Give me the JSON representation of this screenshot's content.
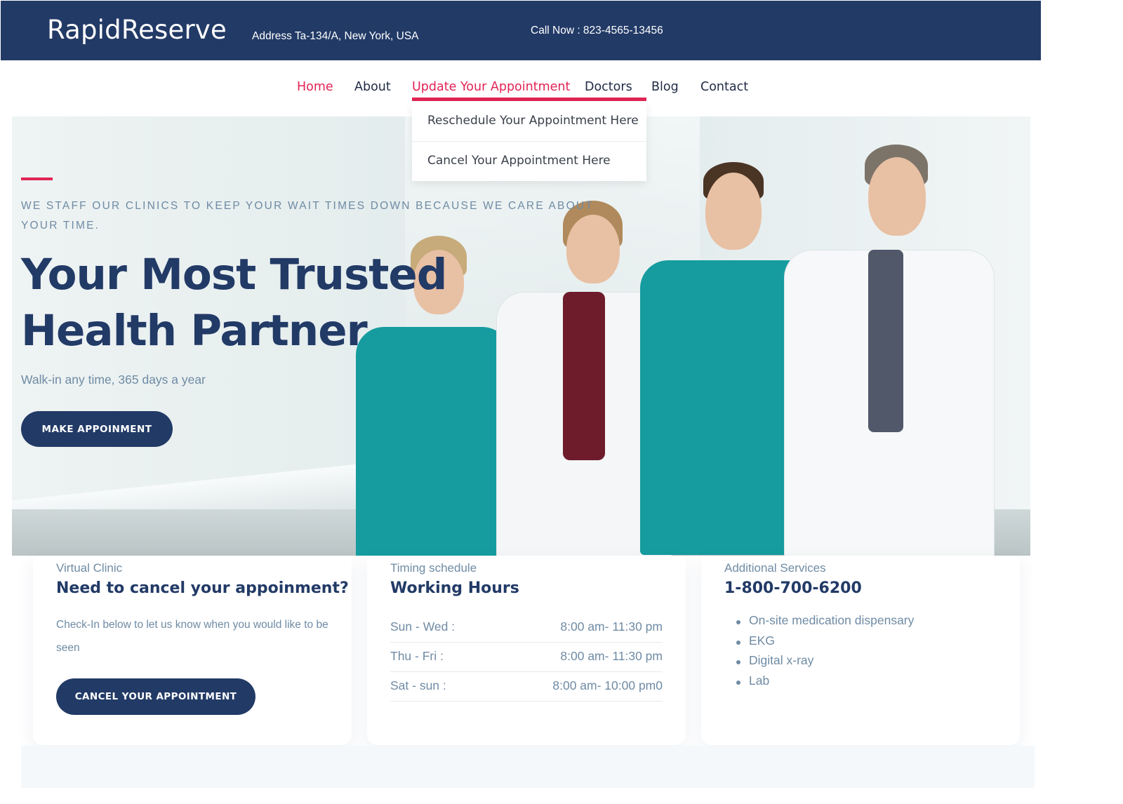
{
  "header": {
    "brand": "RapidReserve",
    "address": "Address Ta-134/A, New York, USA",
    "call": "Call Now : 823-4565-13456"
  },
  "nav": {
    "items": [
      "Home",
      "About",
      "Update Your Appointment",
      "Doctors",
      "Blog",
      "Contact"
    ],
    "active": "Home",
    "open": "Update Your Appointment",
    "dropdown": [
      "Reschedule Your Appointment Here",
      "Cancel Your Appointment Here"
    ]
  },
  "hero": {
    "tagline": "We staff our clinics to keep your wait times down because we care about your time.",
    "headline": "Your Most Trusted Health Partner",
    "subline": "Walk-in any time, 365 days a year",
    "button": "MAKE APPOINMENT"
  },
  "cards": {
    "virtual": {
      "kicker": "Virtual Clinic",
      "title": "Need to cancel your appoinment?",
      "body": "Check-In below to let us know when you would like to be seen",
      "button": "CANCEL YOUR APPOINTMENT"
    },
    "timing": {
      "kicker": "Timing schedule",
      "title": "Working Hours",
      "rows": [
        {
          "day": "Sun - Wed :",
          "time": "8:00 am- 11:30 pm"
        },
        {
          "day": "Thu - Fri :",
          "time": "8:00 am- 11:30 pm"
        },
        {
          "day": "Sat - sun :",
          "time": "8:00 am- 10:00 pm0"
        }
      ]
    },
    "services": {
      "kicker": "Additional Services",
      "title": "1-800-700-6200",
      "items": [
        "On-site medication dispensary",
        "EKG",
        "Digital x-ray",
        "Lab"
      ]
    }
  },
  "colors": {
    "navy": "#223a66",
    "accent": "#e12454",
    "muted": "#6f8ba4",
    "scrubs": "#169c9f"
  }
}
